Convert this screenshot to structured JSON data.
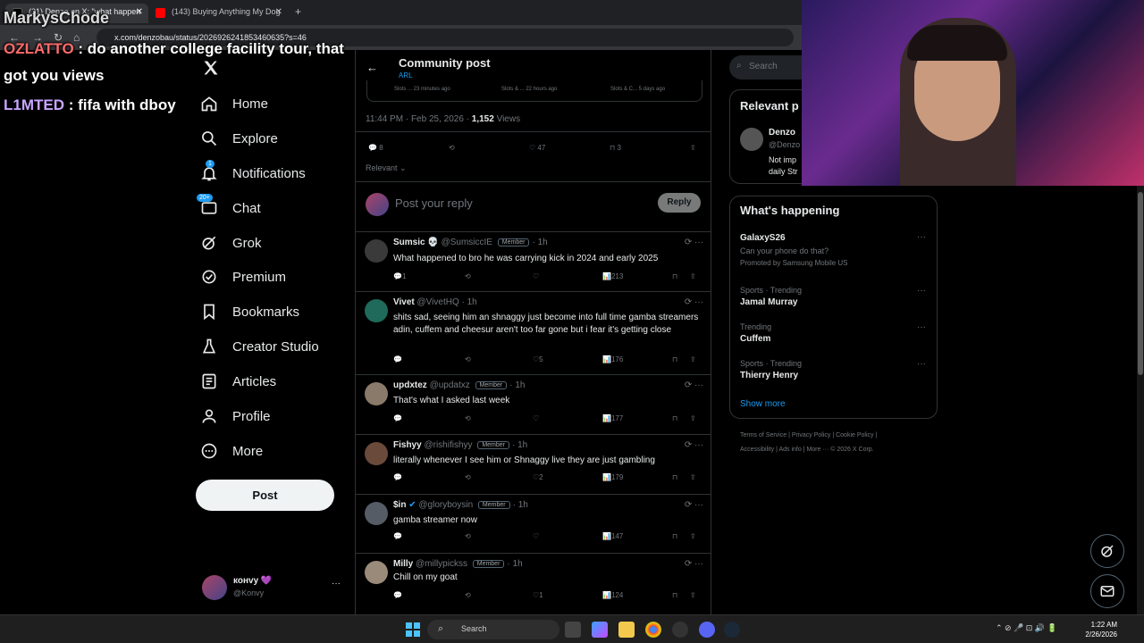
{
  "browser": {
    "tabs": [
      {
        "label": "(31) Denzo on X: \"what happen"
      },
      {
        "label": "(143) Buying Anything My Dog"
      }
    ],
    "url": "x.com/denzobau/status/2026926241853460635?s=46"
  },
  "overlay": {
    "streamer_name": "MarkysChode",
    "chat": [
      {
        "user": "OZLATTO",
        "msg": " : do another college facility tour, that"
      },
      {
        "user": "",
        "msg": "got you views"
      },
      {
        "user": "L1MTED",
        "msg": " : fifa with dboy"
      }
    ]
  },
  "sidebar": {
    "items": [
      {
        "label": "Home",
        "icon": "home-icon"
      },
      {
        "label": "Explore",
        "icon": "search-icon"
      },
      {
        "label": "Notifications",
        "icon": "bell-icon",
        "badge": "1"
      },
      {
        "label": "Chat",
        "icon": "chat-icon",
        "badge": "20+"
      },
      {
        "label": "Grok",
        "icon": "grok-icon"
      },
      {
        "label": "Premium",
        "icon": "premium-icon"
      },
      {
        "label": "Bookmarks",
        "icon": "bookmark-icon"
      },
      {
        "label": "Creator Studio",
        "icon": "flask-icon"
      },
      {
        "label": "Articles",
        "icon": "article-icon"
      },
      {
        "label": "Profile",
        "icon": "profile-icon"
      },
      {
        "label": "More",
        "icon": "more-icon"
      }
    ],
    "post_label": "Post",
    "account": {
      "name": "конvy 💜",
      "handle": "@Konvy"
    }
  },
  "main": {
    "header_title": "Community post",
    "header_sub": "ARL",
    "embed_times": [
      "Slots ... 23 minutes ago",
      "Slots & ... 22 hours ago",
      "Slots & C... 5 days ago"
    ],
    "timestamp": "11:44 PM · Feb 25, 2026 · ",
    "views_count": "1,152",
    "views_label": " Views",
    "stats": {
      "replies": "8",
      "likes": "47",
      "bookmarks": "3"
    },
    "sort_label": "Relevant",
    "reply_placeholder": "Post your reply",
    "reply_button": "Reply",
    "replies": [
      {
        "name": "Sumsic 💀",
        "handle": "@SumsiccIE",
        "member": "Member",
        "time": "1h",
        "text": "What happened to bro he was carrying kick in 2024 and early 2025",
        "replies": "1",
        "rts": "",
        "likes": "",
        "views": "213"
      },
      {
        "name": "Vivet",
        "handle": "@VivetHQ",
        "member": "",
        "time": "1h",
        "text": "shits sad, seeing him an shnaggy just become into full time gamba streamers adin, cuffem and cheesur aren't too far gone but i fear it's getting close",
        "replies": "",
        "rts": "",
        "likes": "5",
        "views": "176"
      },
      {
        "name": "updxtez",
        "handle": "@updatxz",
        "member": "Member",
        "time": "1h",
        "text": "That's what I asked last week",
        "replies": "",
        "rts": "",
        "likes": "",
        "views": "177"
      },
      {
        "name": "Fishyy",
        "handle": "@rishifishyy",
        "member": "Member",
        "time": "1h",
        "text": "literally whenever I see him or Shnaggy live they are just gambling",
        "replies": "",
        "rts": "",
        "likes": "2",
        "views": "179"
      },
      {
        "name": "$in",
        "handle": "@gloryboysin",
        "member": "Member",
        "time": "1h",
        "text": "gamba streamer now",
        "replies": "",
        "rts": "",
        "likes": "",
        "views": "147"
      },
      {
        "name": "Milly",
        "handle": "@millypickss",
        "member": "Member",
        "time": "1h",
        "text": "Chill on my goat",
        "replies": "",
        "rts": "",
        "likes": "1",
        "views": "124"
      }
    ]
  },
  "right": {
    "search_placeholder": "Search",
    "relevant_title": "Relevant p",
    "relevant_name": "Denzo",
    "relevant_handle": "@Denzo",
    "relevant_bio_1": "Not imp",
    "relevant_bio_2": "daily Str",
    "happening_title": "What's happening",
    "trends": [
      {
        "meta": "",
        "title": "GalaxyS26",
        "sub": "Can your phone do that?",
        "promo": "Promoted by Samsung Mobile US"
      },
      {
        "meta": "Sports · Trending",
        "title": "Jamal Murray"
      },
      {
        "meta": "Trending",
        "title": "Cuffem"
      },
      {
        "meta": "Sports · Trending",
        "title": "Thierry Henry"
      }
    ],
    "show_more": "Show more",
    "footer_1": "Terms of Service  |  Privacy Policy  |  Cookie Policy  |",
    "footer_2": "Accessibility  |  Ads info  |  More ···  © 2026 X Corp."
  },
  "taskbar": {
    "search_label": "Search",
    "time": "1:22 AM",
    "date": "2/26/2026"
  },
  "colors": {
    "accent": "#1d9bf0",
    "background": "#000000",
    "text": "#e7e9ea",
    "muted": "#71767b"
  }
}
